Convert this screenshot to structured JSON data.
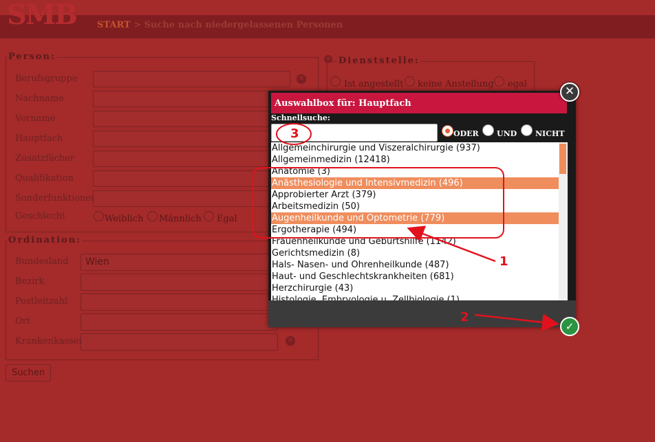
{
  "header": {
    "logo": "SMB",
    "breadcrumb_start": "START",
    "breadcrumb_rest": " > Suche nach niedergelassenen Personen"
  },
  "person": {
    "legend": "Person:",
    "fields": [
      {
        "label": "Berufsgruppe",
        "value": ""
      },
      {
        "label": "Nachname",
        "value": ""
      },
      {
        "label": "Vorname",
        "value": ""
      },
      {
        "label": "Hauptfach",
        "value": ""
      },
      {
        "label": "Zusatzfächer",
        "value": ""
      },
      {
        "label": "Qualifikation",
        "value": ""
      },
      {
        "label": "Sonderfunktionen",
        "value": ""
      }
    ],
    "gender_label": "Geschlecht",
    "gender_options": [
      "Weiblich",
      "Männlich",
      "Egal"
    ]
  },
  "dienststelle": {
    "legend": "Dienststelle:",
    "options": [
      "Ist angestellt",
      "keine Anstellung",
      "egal"
    ]
  },
  "ordination": {
    "legend": "Ordination:",
    "fields": [
      {
        "label": "Bundesland",
        "value": "Wien"
      },
      {
        "label": "Bezirk",
        "value": ""
      },
      {
        "label": "Postleitzahl",
        "value": ""
      },
      {
        "label": "Ort",
        "value": ""
      },
      {
        "label": "Krankenkassen",
        "value": ""
      }
    ]
  },
  "search_button": "Suchen",
  "modal": {
    "title": "Auswahlbox für: Hauptfach",
    "close_symbol": "✕",
    "quick_search_label": "Schnellsuche:",
    "quick_search_value": "",
    "logic_options": [
      {
        "label": "ODER",
        "checked": true
      },
      {
        "label": "UND",
        "checked": false
      },
      {
        "label": "NICHT",
        "checked": false
      }
    ],
    "items": [
      {
        "text": "Allgemeinchirurgie und Viszeralchirurgie  (937)",
        "selected": false
      },
      {
        "text": "Allgemeinmedizin  (12418)",
        "selected": false
      },
      {
        "text": "Anatomie  (3)",
        "selected": false
      },
      {
        "text": "Anästhesiologie und Intensivmedizin  (496)",
        "selected": true
      },
      {
        "text": "Approbierter Arzt  (379)",
        "selected": false
      },
      {
        "text": "Arbeitsmedizin  (50)",
        "selected": false
      },
      {
        "text": "Augenheilkunde und Optometrie  (779)",
        "selected": true
      },
      {
        "text": "Ergotherapie  (494)",
        "selected": false
      },
      {
        "text": "Frauenheilkunde und Geburtshilfe  (1142)",
        "selected": false
      },
      {
        "text": "Gerichtsmedizin  (8)",
        "selected": false
      },
      {
        "text": "Hals- Nasen- und Ohrenheilkunde  (487)",
        "selected": false
      },
      {
        "text": "Haut- und Geschlechtskrankheiten  (681)",
        "selected": false
      },
      {
        "text": "Herzchirurgie  (43)",
        "selected": false
      },
      {
        "text": "Histologie, Embryologie u. Zellbiologie  (1)",
        "selected": false
      }
    ],
    "ok_symbol": "✓"
  },
  "annotations": {
    "n1": "1",
    "n2": "2",
    "n3": "3",
    "color": "#e1121d"
  }
}
